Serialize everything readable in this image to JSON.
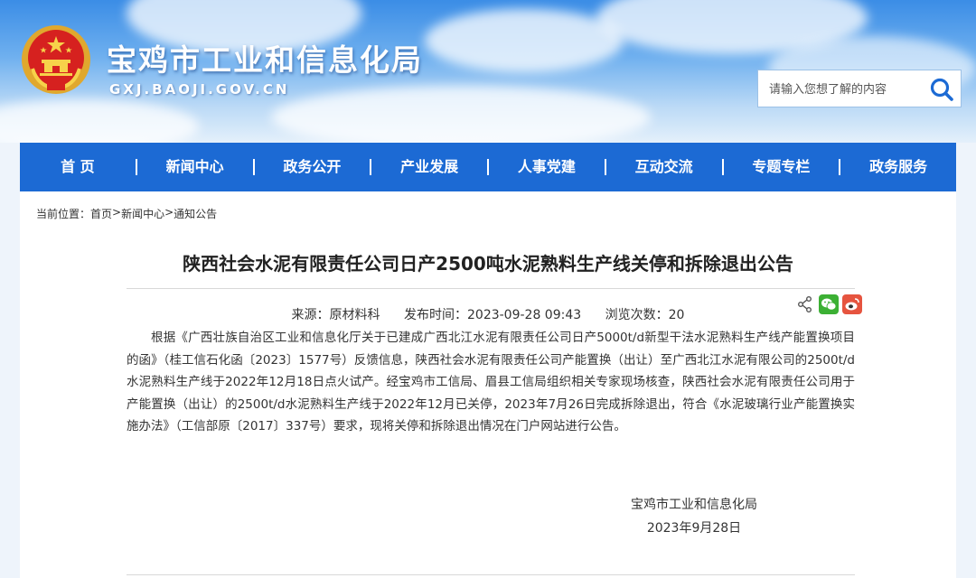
{
  "header": {
    "site_title": "宝鸡市工业和信息化局",
    "site_domain": "GXJ.BAOJI.GOV.CN",
    "search_placeholder": "请输入您想了解的内容"
  },
  "nav": {
    "items": [
      {
        "label": "首 页"
      },
      {
        "label": "新闻中心"
      },
      {
        "label": "政务公开"
      },
      {
        "label": "产业发展"
      },
      {
        "label": "人事党建"
      },
      {
        "label": "互动交流"
      },
      {
        "label": "专题专栏"
      },
      {
        "label": "政务服务"
      }
    ]
  },
  "breadcrumb": {
    "prefix": "当前位置：",
    "items": [
      "首页",
      "新闻中心",
      "通知公告"
    ],
    "separator": ">"
  },
  "article": {
    "title": "陕西社会水泥有限责任公司日产2500吨水泥熟料生产线关停和拆除退出公告",
    "source": "来源：原材料科",
    "published": "发布时间：2023-09-28 09:43",
    "views": "浏览次数：20",
    "body": "根据《广西壮族自治区工业和信息化厅关于已建成广西北江水泥有限责任公司日产5000t/d新型干法水泥熟料生产线产能置换项目的函》（桂工信石化函〔2023〕1577号）反馈信息，陕西社会水泥有限责任公司产能置换（出让）至广西北江水泥有限公司的2500t/d水泥熟料生产线于2022年12月18日点火试产。经宝鸡市工信局、眉县工信局组织相关专家现场核查，陕西社会水泥有限责任公司用于产能置换（出让）的2500t/d水泥熟料生产线于2022年12月已关停，2023年7月26日完成拆除退出，符合《水泥玻璃行业产能置换实施办法》（工信部原〔2017〕337号）要求，现将关停和拆除退出情况在门户网站进行公告。",
    "sign_org": "宝鸡市工业和信息化局",
    "sign_date": "2023年9月28日"
  },
  "icons": {
    "search": "search-icon",
    "share": "share-icon",
    "wechat": "wechat-icon",
    "weibo": "weibo-icon",
    "emblem": "national-emblem-icon"
  },
  "colors": {
    "nav_bg": "#1c6ad4",
    "wechat": "#3cb034",
    "weibo": "#e6543f",
    "search_icon": "#1c6ad4"
  }
}
